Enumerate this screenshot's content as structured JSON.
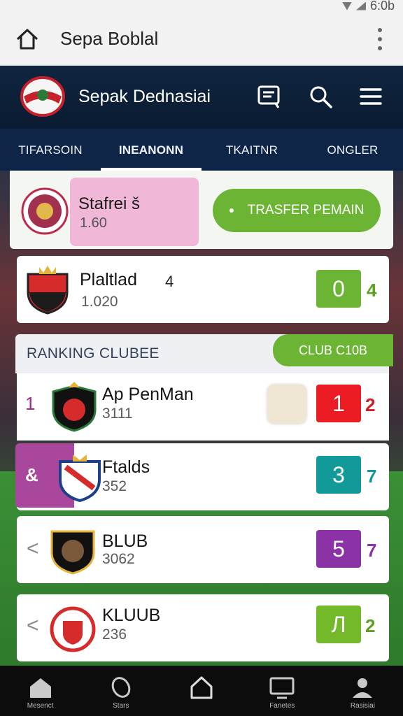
{
  "status_bar": {
    "time": "6:0b"
  },
  "browser": {
    "title": "Sepa Boblal"
  },
  "app": {
    "title": "Sepak Dednasiai"
  },
  "tabs": [
    {
      "label": "TIFARSOIN",
      "active": false
    },
    {
      "label": "INEANONN",
      "active": true
    },
    {
      "label": "TKAITNR",
      "active": false
    },
    {
      "label": "ONGLER",
      "active": false
    }
  ],
  "hero": {
    "name": "Stafrei š",
    "sub": "1.60",
    "transfer_label": "TRASFER PEMAIN"
  },
  "highlight": {
    "name": "Plaltlad",
    "extra": "4",
    "sub": "1.020",
    "score": "0",
    "side": "4"
  },
  "ranking": {
    "header": "RANKING CLUBEE",
    "button": "CLUB C10B",
    "rows": [
      {
        "pos": "1",
        "name": "Ap PenMan",
        "num": "3111",
        "score": "1",
        "side": "2",
        "score_color": "#ec1c24",
        "side_color": "#d41c24"
      },
      {
        "pos": "&",
        "name": "Ftalds",
        "num": "352",
        "score": "3",
        "side": "7",
        "score_color": "#119a98",
        "side_color": "#119a98"
      },
      {
        "pos": "<",
        "name": "BLUB",
        "num": "3062",
        "score": "5",
        "side": "7",
        "score_color": "#8b33a6",
        "side_color": "#8b33a6"
      },
      {
        "pos": "<",
        "name": "KLUUB",
        "num": "236",
        "score": "Л",
        "side": "2",
        "score_color": "#74b92a",
        "side_color": "#5ea020"
      }
    ]
  },
  "bottom_nav": [
    {
      "label": "Mesenct",
      "icon": "stadium-icon"
    },
    {
      "label": "Stars",
      "icon": "ball-icon"
    },
    {
      "label": "",
      "icon": "home-icon"
    },
    {
      "label": "Fanetes",
      "icon": "screen-icon"
    },
    {
      "label": "Rasisiai",
      "icon": "profile-icon"
    }
  ],
  "colors": {
    "accent_green": "#6cb534",
    "header_bg": "#0f2540"
  }
}
